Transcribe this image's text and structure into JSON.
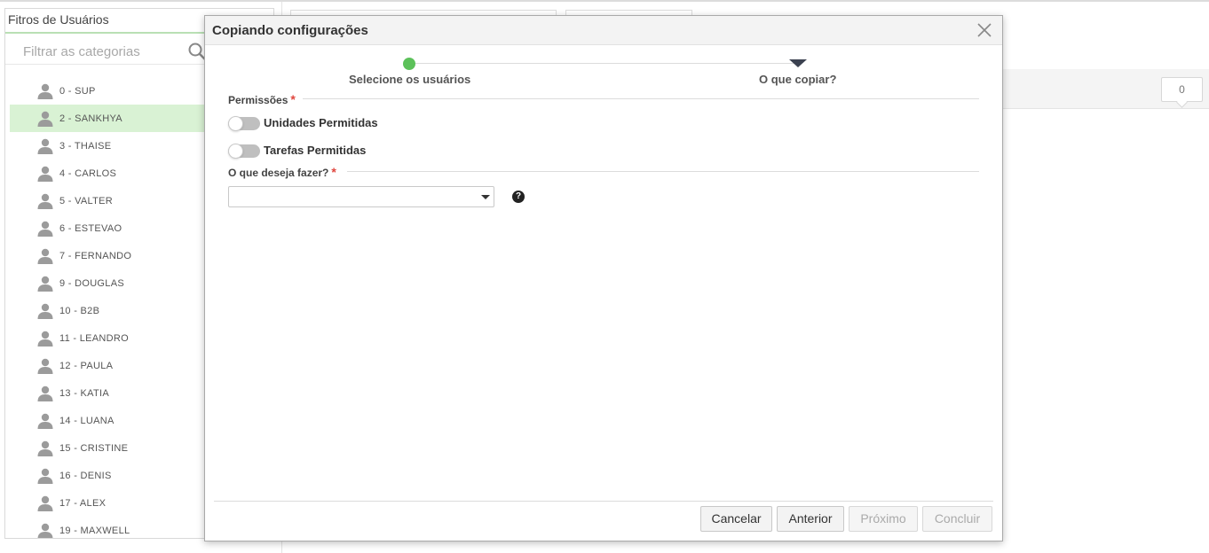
{
  "left_panel": {
    "title": "Fitros de Usuários",
    "filter_placeholder": "Filtrar as categorias",
    "users": [
      {
        "label": "0 - SUP",
        "selected": false
      },
      {
        "label": "2 - SANKHYA",
        "selected": true
      },
      {
        "label": "3 - THAISE",
        "selected": false
      },
      {
        "label": "4 - CARLOS",
        "selected": false
      },
      {
        "label": "5 - VALTER",
        "selected": false
      },
      {
        "label": "6 - ESTEVAO",
        "selected": false
      },
      {
        "label": "7 - FERNANDO",
        "selected": false
      },
      {
        "label": "9 - DOUGLAS",
        "selected": false
      },
      {
        "label": "10 - B2B",
        "selected": false
      },
      {
        "label": "11 - LEANDRO",
        "selected": false
      },
      {
        "label": "12 - PAULA",
        "selected": false
      },
      {
        "label": "13 - KATIA",
        "selected": false
      },
      {
        "label": "14 - LUANA",
        "selected": false
      },
      {
        "label": "15 - CRISTINE",
        "selected": false
      },
      {
        "label": "16 - DENIS",
        "selected": false
      },
      {
        "label": "17 - ALEX",
        "selected": false
      },
      {
        "label": "19 - MAXWELL",
        "selected": false
      }
    ]
  },
  "background": {
    "counter": "0"
  },
  "modal": {
    "title": "Copiando configurações",
    "steps": [
      {
        "label": "Selecione os usuários",
        "state": "done"
      },
      {
        "label": "O que copiar?",
        "state": "current"
      }
    ],
    "permissions": {
      "label": "Permissões",
      "required_mark": "*",
      "toggles": [
        {
          "label": "Unidades Permitidas",
          "on": false
        },
        {
          "label": "Tarefas Permitidas",
          "on": false
        }
      ]
    },
    "action": {
      "label": "O que deseja fazer?",
      "required_mark": "*",
      "selected_value": "",
      "help_glyph": "?"
    },
    "buttons": {
      "cancel": "Cancelar",
      "previous": "Anterior",
      "next": "Próximo",
      "finish": "Concluir"
    }
  },
  "colors": {
    "accent_green": "#5cc15a",
    "selected_row": "#d9f2d4",
    "required_red": "#e0463e"
  }
}
